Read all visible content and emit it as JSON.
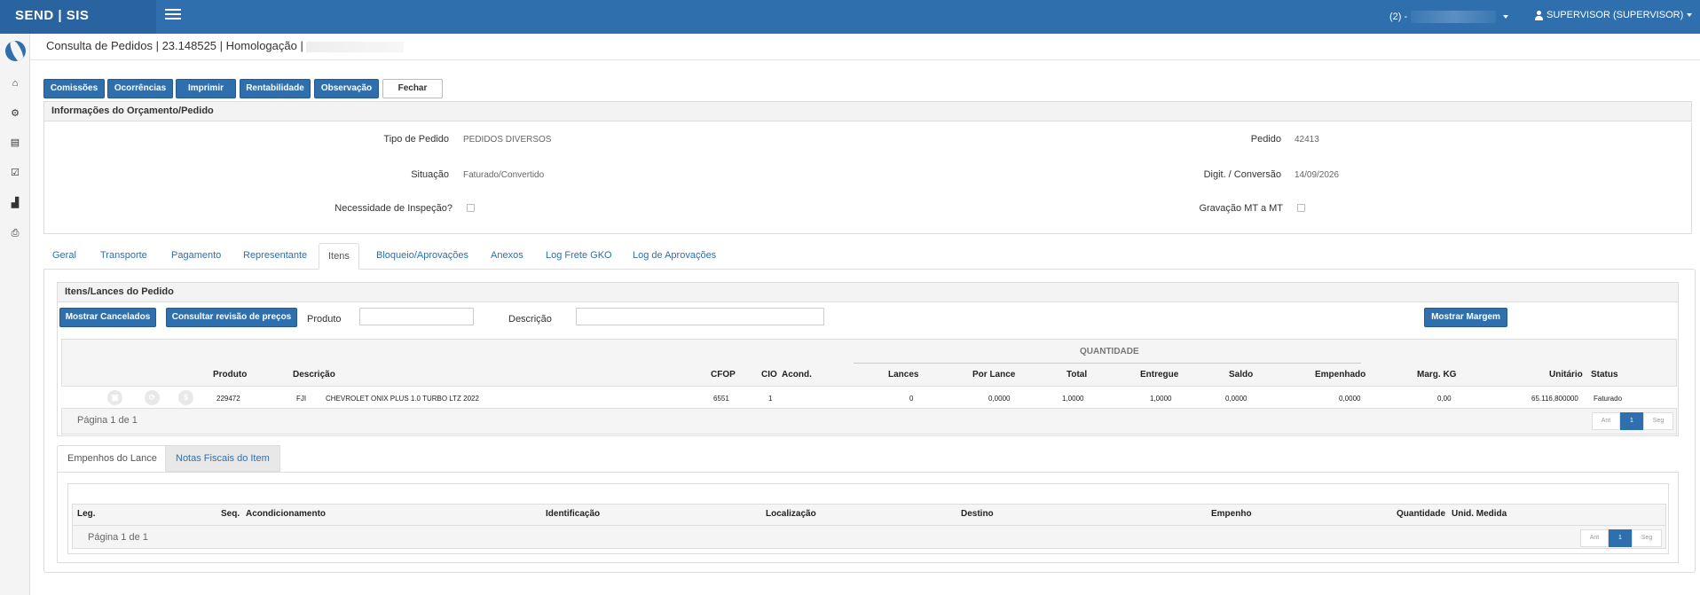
{
  "app": {
    "brand": "SEND | SIS"
  },
  "topbar": {
    "company_prefix": "(2) -",
    "user_label": "SUPERVISOR (SUPERVISOR)"
  },
  "sidebar": {
    "icons": [
      {
        "name": "home-icon",
        "glyph": "⌂"
      },
      {
        "name": "gears-icon",
        "glyph": "⚙"
      },
      {
        "name": "cart-icon",
        "glyph": "▤"
      },
      {
        "name": "checklist-icon",
        "glyph": "☑"
      },
      {
        "name": "factory-icon",
        "glyph": "▟"
      },
      {
        "name": "print-icon",
        "glyph": "⎙"
      }
    ]
  },
  "page": {
    "title": "Consulta de Pedidos | 23.148525 | Homologação |"
  },
  "toolbar": {
    "comissoes": "Comissões",
    "ocorrencias": "Ocorrências",
    "imprimir": "Imprimir",
    "rentabilidade": "Rentabilidade",
    "observacao": "Observação",
    "fechar": "Fechar"
  },
  "info": {
    "heading": "Informações do Orçamento/Pedido",
    "tipo_label": "Tipo de Pedido",
    "tipo_value": "PEDIDOS DIVERSOS",
    "situacao_label": "Situação",
    "situacao_value": "Faturado/Convertido",
    "inspecao_label": "Necessidade de Inspeção?",
    "pedido_label": "Pedido",
    "pedido_value": "42413",
    "digit_label": "Digit. / Conversão",
    "digit_value": "14/09/2026",
    "gravacao_label": "Gravação MT a MT"
  },
  "tabs": [
    "Geral",
    "Transporte",
    "Pagamento",
    "Representante",
    "Itens",
    "Bloqueio/Aprovações",
    "Anexos",
    "Log Frete GKO",
    "Log de Aprovações"
  ],
  "items": {
    "heading": "Itens/Lances do Pedido",
    "mostrar_cancelados": "Mostrar Cancelados",
    "consultar_revisao": "Consultar revisão de preços",
    "produto_label": "Produto",
    "descricao_label": "Descrição",
    "mostrar_margem": "Mostrar Margem",
    "quantidade_group": "QUANTIDADE",
    "columns": {
      "produto": "Produto",
      "descricao": "Descrição",
      "cfop": "CFOP",
      "cio": "CIO",
      "acond": "Acond.",
      "lances": "Lances",
      "por_lance": "Por Lance",
      "total": "Total",
      "entregue": "Entregue",
      "saldo": "Saldo",
      "empenhado": "Empenhado",
      "marg_kg": "Marg. KG",
      "unitario": "Unitário",
      "status": "Status"
    },
    "row": {
      "produto": "229472",
      "tipo": "FJI",
      "descricao": "CHEVROLET ONIX PLUS 1.0 TURBO LTZ 2022",
      "cfop": "6551",
      "cio": "1",
      "lances": "0",
      "por_lance": "0,0000",
      "total": "1,0000",
      "entregue": "1,0000",
      "saldo": "0,0000",
      "empenhado": "0,0000",
      "marg_kg": "0,00",
      "unitario": "65.116,800000",
      "status": "Faturado"
    },
    "pagination": "Página 1 de 1",
    "pager": {
      "prev": "Ant",
      "page": "1",
      "next": "Seg"
    }
  },
  "bottom": {
    "tab_empenhos": "Empenhos do Lance",
    "tab_notas": "Notas Fiscais do Item",
    "columns": {
      "leg": "Leg.",
      "seq": "Seq.",
      "acond": "Acondicionamento",
      "ident": "Identificação",
      "local": "Localização",
      "destino": "Destino",
      "empenho": "Empenho",
      "quantidade": "Quantidade",
      "unid": "Unid. Medida"
    },
    "pagination": "Página 1 de 1",
    "pager": {
      "prev": "Ant",
      "page": "1",
      "next": "Seg"
    }
  }
}
